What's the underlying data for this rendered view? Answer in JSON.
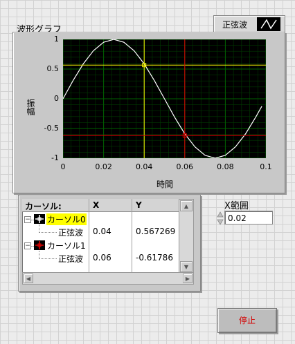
{
  "graph": {
    "title": "波形グラフ",
    "legend_label": "正弦波",
    "xlabel": "時間",
    "ylabel": "振幅"
  },
  "chart_data": {
    "type": "line",
    "series": [
      {
        "name": "正弦波",
        "x": [
          0,
          0.005,
          0.01,
          0.015,
          0.02,
          0.025,
          0.03,
          0.035,
          0.04,
          0.045,
          0.05,
          0.055,
          0.06,
          0.065,
          0.07,
          0.075,
          0.08,
          0.085,
          0.09,
          0.095,
          0.098
        ],
        "y": [
          0,
          0.309,
          0.588,
          0.809,
          0.951,
          1.0,
          0.951,
          0.809,
          0.588,
          0.309,
          0,
          -0.309,
          -0.588,
          -0.809,
          -0.951,
          -1.0,
          -0.951,
          -0.809,
          -0.588,
          -0.309,
          -0.125
        ]
      }
    ],
    "xlim": [
      0,
      0.1
    ],
    "ylim": [
      -1,
      1
    ],
    "xticks": [
      "0",
      "0.02",
      "0.04",
      "0.06",
      "0.08",
      "0.1"
    ],
    "yticks": [
      "1",
      "0.5",
      "0",
      "-0.5",
      "-1"
    ],
    "grid": true,
    "cursors": [
      {
        "x": 0.04,
        "y": 0.567269,
        "color": "#ffff00"
      },
      {
        "x": 0.06,
        "y": -0.61786,
        "color": "#e00000"
      }
    ],
    "colors": {
      "background": "#000000",
      "grid": "#006000",
      "line": "#ffffff"
    }
  },
  "cursor_table": {
    "headers": [
      "カーソル:",
      "X",
      "Y"
    ],
    "rows": [
      {
        "name": "カーソル0",
        "plot": "正弦波",
        "x": "0.04",
        "y": "0.567269"
      },
      {
        "name": "カーソル1",
        "plot": "正弦波",
        "x": "0.06",
        "y": "-0.61786"
      }
    ]
  },
  "xrange": {
    "label": "X範囲",
    "value": "0.02"
  },
  "stop_button": {
    "label": "停止"
  }
}
